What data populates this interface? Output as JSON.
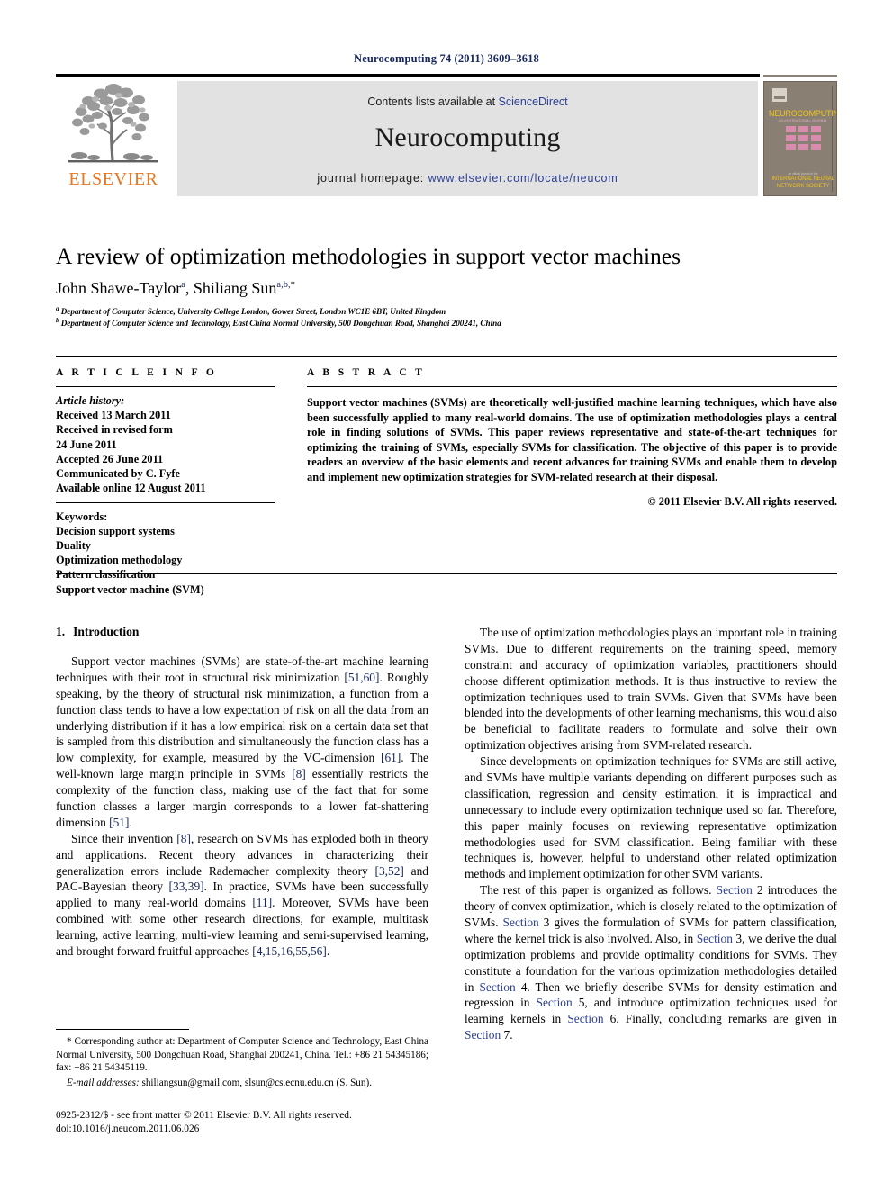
{
  "running_head": "Neurocomputing 74 (2011) 3609–3618",
  "masthead": {
    "contents_prefix": "Contents lists available at ",
    "sciencedirect": "ScienceDirect",
    "journal_name": "Neurocomputing",
    "homepage_prefix": "journal homepage: ",
    "homepage_url": "www.elsevier.com/locate/neucom",
    "publisher_wordmark": "ELSEVIER",
    "cover": {
      "title": "NEUROCOMPUTING",
      "subtitle": "AN INTERNATIONAL JOURNAL",
      "footer_small": "an official journal of the",
      "footer_line1": "INTERNATIONAL NEURAL",
      "footer_line2": "NETWORK SOCIETY"
    },
    "link_color": "#2c3f93",
    "accent_color": "#e87722",
    "banner_bg": "#e2e2e2"
  },
  "article": {
    "title": "A review of optimization methodologies in support vector machines",
    "authors": "John Shawe-Taylor , Shiliang Sun",
    "author1_name": "John Shawe-Taylor",
    "author1_sup": "a",
    "author2_name": "Shiliang Sun",
    "author2_sup": "a,b,",
    "author2_star": "*",
    "affiliation_a_sup": "a",
    "affiliation_a": "Department of Computer Science, University College London, Gower Street, London WC1E 6BT, United Kingdom",
    "affiliation_b_sup": "b",
    "affiliation_b": "Department of Computer Science and Technology, East China Normal University, 500 Dongchuan Road, Shanghai 200241, China"
  },
  "article_info": {
    "heading": "A R T I C L E   I N F O",
    "history_label": "Article history:",
    "history": [
      "Received 13 March 2011",
      "Received in revised form",
      "24 June 2011",
      "Accepted 26 June 2011",
      "Communicated by C. Fyfe",
      "Available online 12 August 2011"
    ],
    "keywords_label": "Keywords:",
    "keywords": [
      "Decision support systems",
      "Duality",
      "Optimization methodology",
      "Pattern classification",
      "Support vector machine (SVM)"
    ]
  },
  "abstract": {
    "heading": "A B S T R A C T",
    "text": "Support vector machines (SVMs) are theoretically well-justified machine learning techniques, which have also been successfully applied to many real-world domains. The use of optimization methodologies plays a central role in finding solutions of SVMs. This paper reviews representative and state-of-the-art techniques for optimizing the training of SVMs, especially SVMs for classification. The objective of this paper is to provide readers an overview of the basic elements and recent advances for training SVMs and enable them to develop and implement new optimization strategies for SVM-related research at their disposal.",
    "copyright": "© 2011 Elsevier B.V. All rights reserved."
  },
  "body": {
    "section1_number": "1.",
    "section1_title": "Introduction",
    "left_para1_a": "Support vector machines (SVMs) are state-of-the-art machine learning techniques with their root in structural risk minimization ",
    "left_para1_cite1": "[51,60]",
    "left_para1_b": ". Roughly speaking, by the theory of structural risk minimization, a function from a function class tends to have a low expectation of risk on all the data from an underlying distribution if it has a low empirical risk on a certain data set that is sampled from this distribution and simultaneously the function class has a low complexity, for example, measured by the VC-dimension ",
    "left_para1_cite2": "[61]",
    "left_para1_c": ". The well-known large margin principle in SVMs ",
    "left_para1_cite3": "[8]",
    "left_para1_d": " essentially restricts the complexity of the function class, making use of the fact that for some function classes a larger margin corresponds to a lower fat-shattering dimension ",
    "left_para1_cite4": "[51]",
    "left_para1_e": ".",
    "left_para2_a": "Since their invention ",
    "left_para2_cite1": "[8]",
    "left_para2_b": ", research on SVMs has exploded both in theory and applications. Recent theory advances in characterizing their generalization errors include Rademacher complexity theory ",
    "left_para2_cite2": "[3,52]",
    "left_para2_c": " and PAC-Bayesian theory ",
    "left_para2_cite3": "[33,39]",
    "left_para2_d": ". In practice, SVMs have been successfully applied to many real-world domains ",
    "left_para2_cite4": "[11]",
    "left_para2_e": ". Moreover, SVMs have been combined with some other research directions, for example, multitask learning, active learning, multi-view learning and semi-supervised learning, and brought forward fruitful approaches ",
    "left_para2_cite5": "[4,15,16,55,56]",
    "left_para2_f": ".",
    "right_para1": "The use of optimization methodologies plays an important role in training SVMs. Due to different requirements on the training speed, memory constraint and accuracy of optimization variables, practitioners should choose different optimization methods. It is thus instructive to review the optimization techniques used to train SVMs. Given that SVMs have been blended into the developments of other learning mechanisms, this would also be beneficial to facilitate readers to formulate and solve their own optimization objectives arising from SVM-related research.",
    "right_para2": "Since developments on optimization techniques for SVMs are still active, and SVMs have multiple variants depending on different purposes such as classification, regression and density estimation, it is impractical and unnecessary to include every optimization technique used so far. Therefore, this paper mainly focuses on reviewing representative optimization methodologies used for SVM classification. Being familiar with these techniques is, however, helpful to understand other related optimization methods and implement optimization for other SVM variants.",
    "right_para3_a": "The rest of this paper is organized as follows. ",
    "right_para3_ref1": "Section",
    "right_para3_b": " 2 introduces the theory of convex optimization, which is closely related to the optimization of SVMs. ",
    "right_para3_ref2": "Section",
    "right_para3_c": " 3 gives the formulation of SVMs for pattern classification, where the kernel trick is also involved. Also, in ",
    "right_para3_ref3": "Section",
    "right_para3_d": " 3, we derive the dual optimization problems and provide optimality conditions for SVMs. They constitute a foundation for the various optimization methodologies detailed in ",
    "right_para3_ref4": "Section",
    "right_para3_e": " 4. Then we briefly describe SVMs for density estimation and regression in ",
    "right_para3_ref5": "Section",
    "right_para3_f": " 5, and introduce optimization techniques used for learning kernels in ",
    "right_para3_ref6": "Section",
    "right_para3_g": " 6. Finally, concluding remarks are given in ",
    "right_para3_ref7": "Section",
    "right_para3_h": " 7."
  },
  "footnotes": {
    "corresponding_star": "*",
    "corresponding": " Corresponding author at: Department of Computer Science and Technology, East China Normal University, 500 Dongchuan Road, Shanghai 200241, China. Tel.: +86 21 54345186; fax: +86 21 54345119.",
    "email_label": "E-mail addresses:",
    "email_text": " shiliangsun@gmail.com, slsun@cs.ecnu.edu.cn (S. Sun)."
  },
  "imprint": {
    "issn_line": "0925-2312/$ - see front matter © 2011 Elsevier B.V. All rights reserved.",
    "doi_line": "doi:10.1016/j.neucom.2011.06.026"
  }
}
